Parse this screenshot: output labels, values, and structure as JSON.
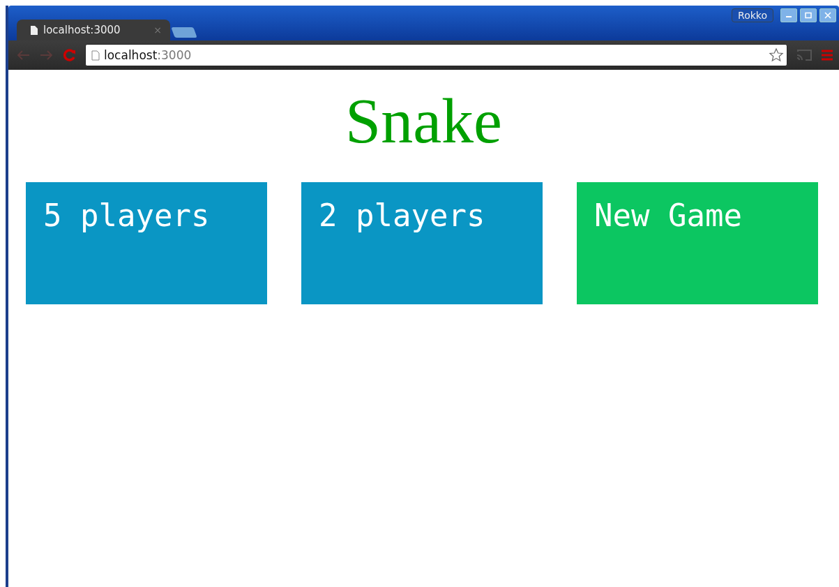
{
  "window": {
    "user": "Rokko"
  },
  "tabs": [
    {
      "title": "localhost:3000",
      "close": "×",
      "selected": true
    }
  ],
  "address_bar": {
    "host": "localhost",
    "port": ":3000"
  },
  "page": {
    "title": "Snake",
    "cards": [
      {
        "label": "5 players",
        "color": "#0a96c4"
      },
      {
        "label": "2 players",
        "color": "#0a96c4"
      },
      {
        "label": "New Game",
        "color": "#0cc661"
      }
    ]
  }
}
